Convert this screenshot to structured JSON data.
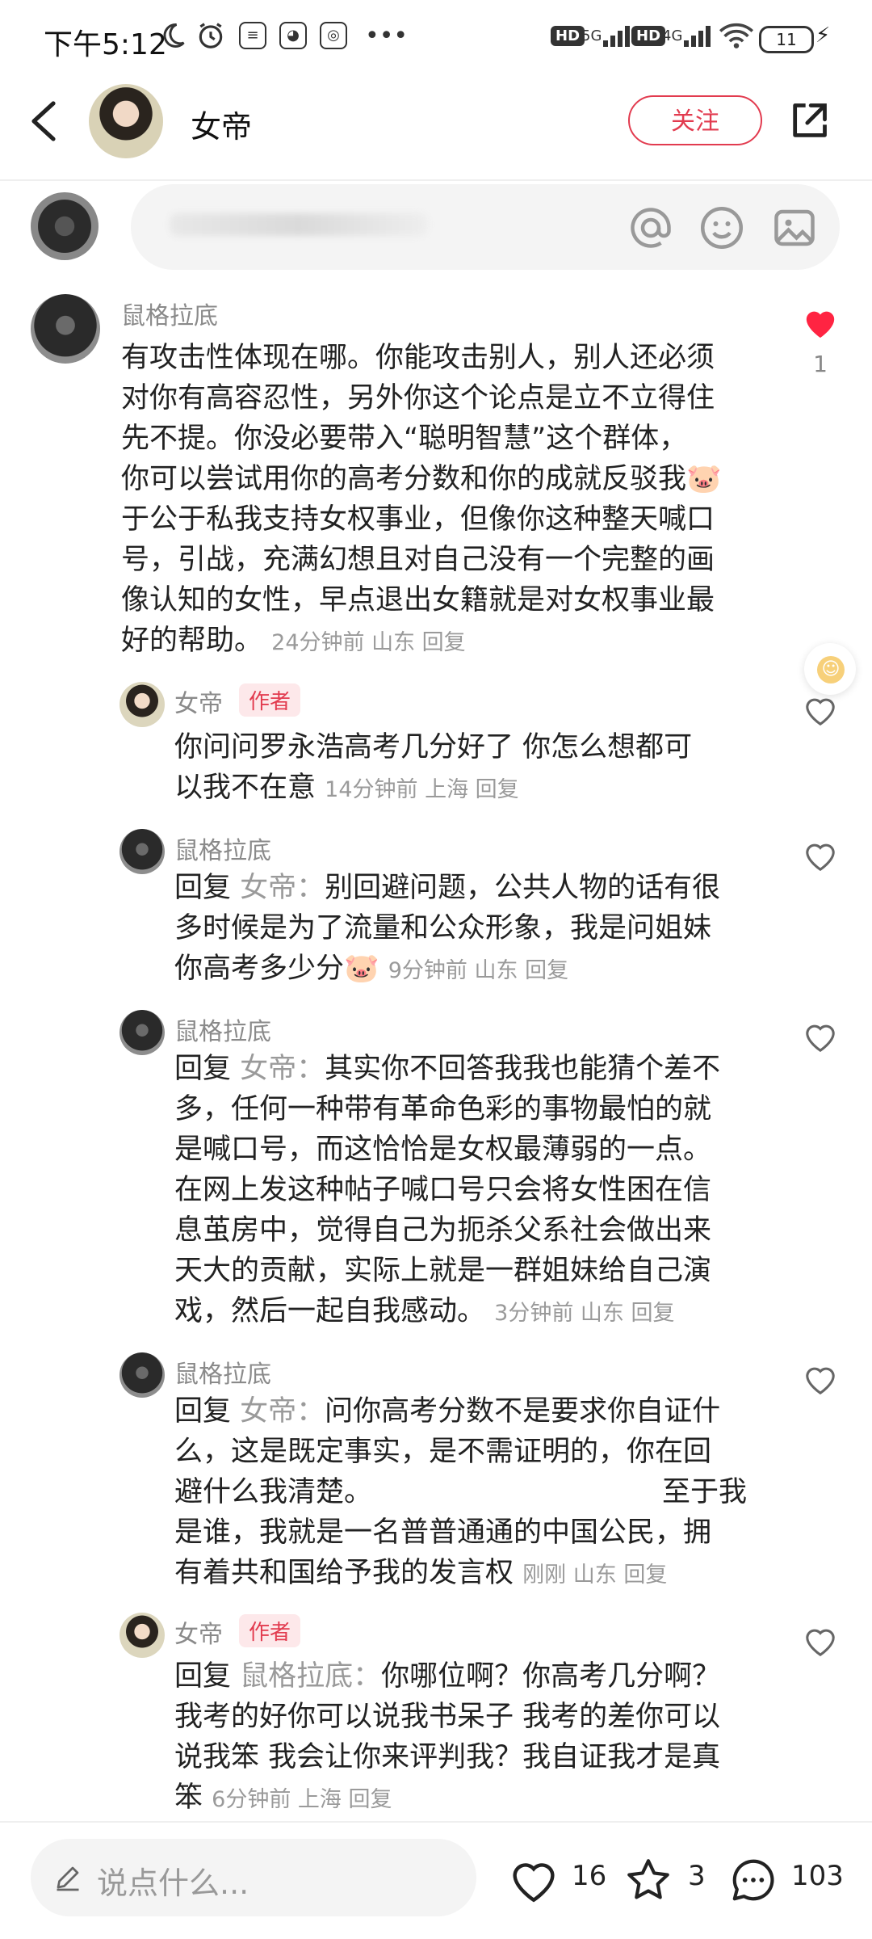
{
  "status_bar": {
    "time": "下午5:12",
    "network_1": "5G",
    "network_2": "4G",
    "hd_label": "HD",
    "battery": "11"
  },
  "header": {
    "title": "女帝",
    "follow_label": "关注"
  },
  "comments": [
    {
      "author": "鼠格拉底",
      "lines": [
        "有攻击性体现在哪。你能攻击别人，别人还必须",
        "对你有高容忍性，另外你这个论点是立不立得住",
        "先不提。你没必要带入“聪明智慧”这个群体，",
        "你可以尝试用你的高考分数和你的成就反驳我",
        "于公于私我支持女权事业，但像你这种整天喊口",
        "号，引战，充满幻想且对自己没有一个完整的画",
        "像认知的女性，早点退出女籍就是对女权事业最",
        "好的帮助。"
      ],
      "meta": "24分钟前  山东  回复",
      "likes": "1"
    },
    {
      "author": "女帝",
      "badge": "作者",
      "lines": [
        "你问问罗永浩高考几分好了  你怎么想都可",
        "以我不在意"
      ],
      "meta": "14分钟前  上海  回复"
    },
    {
      "author": "鼠格拉底",
      "reply_prefix": "回复 ",
      "reply_to": "女帝：",
      "lines": [
        "别回避问题，公共人物的话有很",
        "多时候是为了流量和公众形象，我是问姐妹",
        "你高考多少分"
      ],
      "meta": "9分钟前  山东  回复"
    },
    {
      "author": "鼠格拉底",
      "reply_prefix": "回复 ",
      "reply_to": "女帝：",
      "lines": [
        "其实你不回答我我也能猜个差不",
        "多，任何一种带有革命色彩的事物最怕的就",
        "是喊口号，而这恰恰是女权最薄弱的一点。",
        "在网上发这种帖子喊口号只会将女性困在信",
        "息茧房中，觉得自己为扼杀父系社会做出来",
        "天大的贡献，实际上就是一群姐妹给自己演",
        "戏，然后一起自我感动。"
      ],
      "meta": "3分钟前  山东  回复"
    },
    {
      "author": "鼠格拉底",
      "reply_prefix": "回复 ",
      "reply_to": "女帝：",
      "lines": [
        "问你高考分数不是要求你自证什",
        "么，这是既定事实，是不需证明的，你在回",
        "避什么我清楚。",
        "是谁，我就是一名普普通通的中国公民，拥",
        "有着共和国给予我的发言权"
      ],
      "extra": "至于我",
      "meta": "刚刚  山东  回复"
    },
    {
      "author": "女帝",
      "badge": "作者",
      "reply_prefix": "回复 ",
      "reply_to": "鼠格拉底：",
      "lines": [
        "你哪位啊？你高考几分啊？",
        "我考的好你可以说我书呆子 我考的差你可以",
        "说我笨  我会让你来评判我？我自证我才是真",
        "笨"
      ],
      "meta": "6分钟前  上海  回复"
    }
  ],
  "bottom_bar": {
    "placeholder": "说点什么...",
    "likes": "16",
    "stars": "3",
    "comments": "103"
  },
  "colors": {
    "accent": "#e23b4f",
    "like_red": "#ff2442",
    "meta_gray": "#9a9a9a"
  }
}
